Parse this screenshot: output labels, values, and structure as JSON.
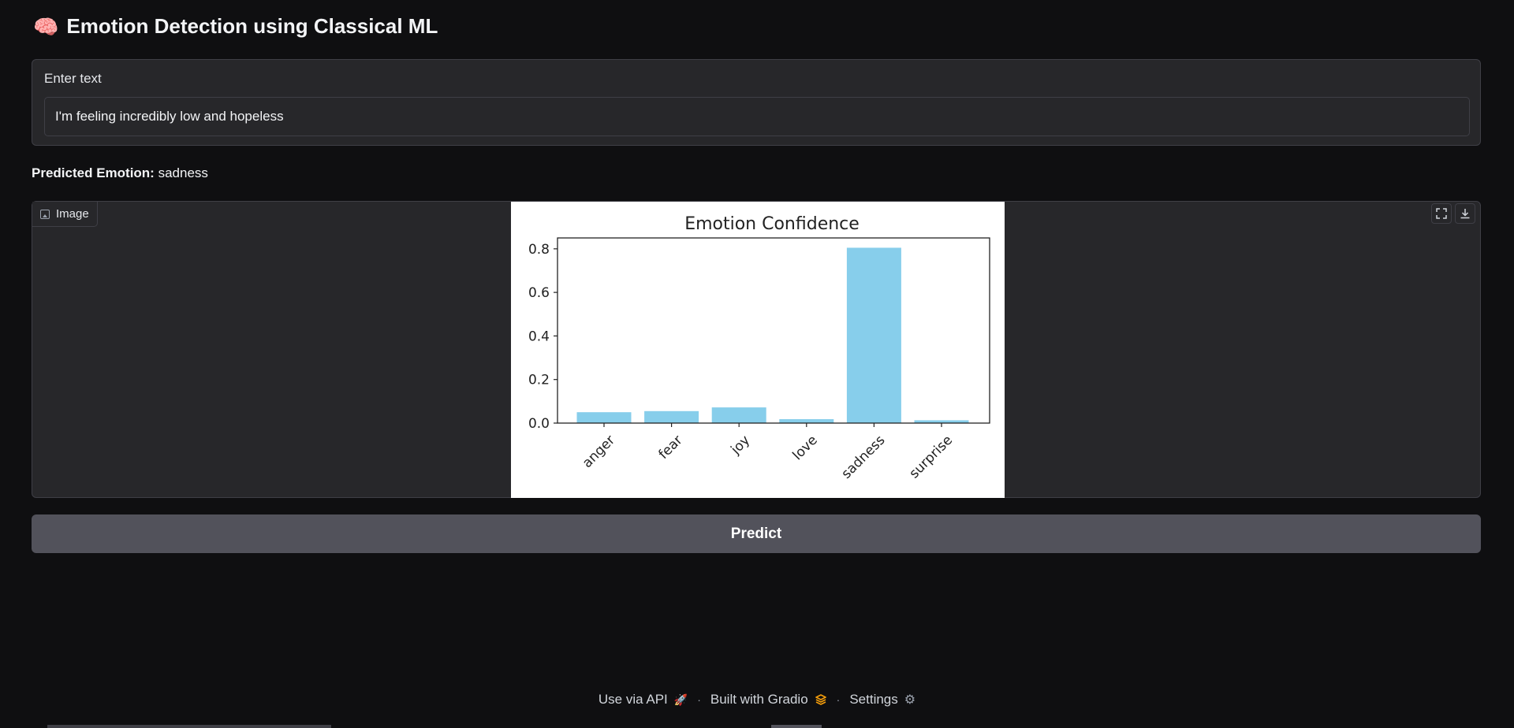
{
  "header": {
    "icon": "🧠",
    "title": "Emotion Detection using Classical ML"
  },
  "input": {
    "label": "Enter text",
    "value": "I'm feeling incredibly low and hopeless"
  },
  "prediction": {
    "label": "Predicted Emotion:",
    "value": "sadness"
  },
  "image_panel": {
    "tag_label": "Image",
    "tag_icon": "image-icon",
    "fullscreen_icon": "fullscreen-icon",
    "download_icon": "download-icon"
  },
  "chart_data": {
    "type": "bar",
    "title": "Emotion Confidence",
    "categories": [
      "anger",
      "fear",
      "joy",
      "love",
      "sadness",
      "surprise"
    ],
    "values": [
      0.05,
      0.055,
      0.072,
      0.018,
      0.805,
      0.013
    ],
    "ylim": [
      0,
      0.85
    ],
    "yticks": [
      "0.0",
      "0.2",
      "0.4",
      "0.6",
      "0.8"
    ],
    "xlabel": "",
    "ylabel": "",
    "bar_color": "#87CEEB",
    "grid": false
  },
  "actions": {
    "predict_label": "Predict"
  },
  "footer": {
    "api_label": "Use via API",
    "gradio_label": "Built with Gradio",
    "settings_label": "Settings",
    "separator": "·"
  },
  "colors": {
    "background": "#0f0f11",
    "panel": "#27272a",
    "button": "#52525b"
  }
}
